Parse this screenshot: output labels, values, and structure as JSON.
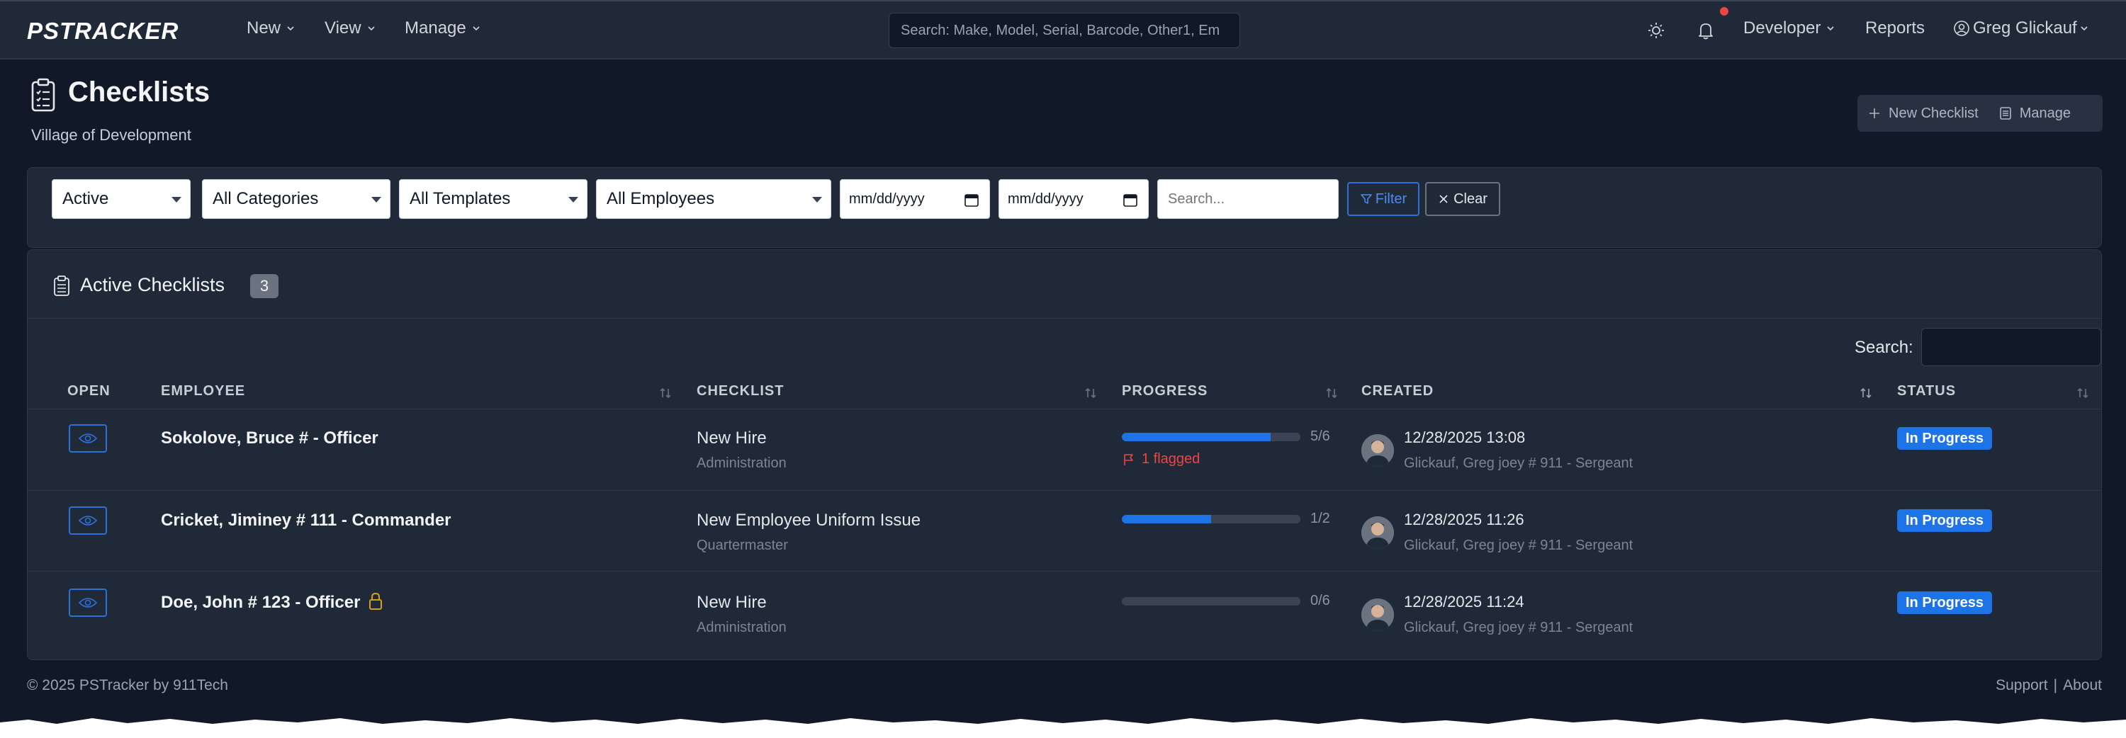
{
  "app": {
    "brand": "PSTRACKER",
    "nav": {
      "new": "New",
      "view": "View",
      "manage": "Manage"
    },
    "search_placeholder": "Search: Make, Model, Serial, Barcode, Other1, Em",
    "right_nav": {
      "developer": "Developer",
      "reports": "Reports",
      "user": "Greg Glickauf"
    }
  },
  "page": {
    "title": "Checklists",
    "subtitle": "Village of Development",
    "actions": {
      "new_checklist": "New Checklist",
      "manage": "Manage"
    }
  },
  "filters": {
    "status": "Active",
    "category": "All Categories",
    "template": "All Templates",
    "employee": "All Employees",
    "date_from": "mm/dd/yyyy",
    "date_to": "mm/dd/yyyy",
    "search_placeholder": "Search...",
    "filter_label": "Filter",
    "clear_label": "Clear"
  },
  "table": {
    "title": "Active Checklists",
    "count": "3",
    "search_label": "Search:",
    "columns": {
      "open": "OPEN",
      "employee": "EMPLOYEE",
      "checklist": "CHECKLIST",
      "progress": "PROGRESS",
      "created": "CREATED",
      "status": "STATUS"
    },
    "rows": [
      {
        "employee": "Sokolove, Bruce # - Officer",
        "checklist": "New Hire",
        "category": "Administration",
        "progress_label": "5/6",
        "progress_fraction": 0.833,
        "flagged": "1 flagged",
        "created_ts": "12/28/2025 13:08",
        "created_by": "Glickauf, Greg joey # 911 - Sergeant",
        "status": "In Progress",
        "locked": false
      },
      {
        "employee": "Cricket, Jiminey # 111 - Commander",
        "checklist": "New Employee Uniform Issue",
        "category": "Quartermaster",
        "progress_label": "1/2",
        "progress_fraction": 0.5,
        "flagged": "",
        "created_ts": "12/28/2025 11:26",
        "created_by": "Glickauf, Greg joey # 911 - Sergeant",
        "status": "In Progress",
        "locked": false
      },
      {
        "employee": "Doe, John # 123 - Officer",
        "checklist": "New Hire",
        "category": "Administration",
        "progress_label": "0/6",
        "progress_fraction": 0,
        "flagged": "",
        "created_ts": "12/28/2025 11:24",
        "created_by": "Glickauf, Greg joey # 911 - Sergeant",
        "status": "In Progress",
        "locked": true
      }
    ]
  },
  "footer": {
    "copyright": "© 2025  PSTracker by 911Tech",
    "support": "Support",
    "separator": "|",
    "about": "About"
  },
  "colors": {
    "accent": "#1d74e6",
    "flag": "#ef4444",
    "lock": "#d4a017",
    "background": "#111827",
    "card": "#1f2937"
  },
  "icons": [
    "clipboard-icon",
    "sun-icon",
    "bell-icon",
    "user-circle-icon",
    "plus-icon",
    "list-icon",
    "filter-icon",
    "x-icon",
    "eye-icon",
    "flag-icon",
    "lock-icon",
    "sort-icon",
    "calendar-icon"
  ]
}
